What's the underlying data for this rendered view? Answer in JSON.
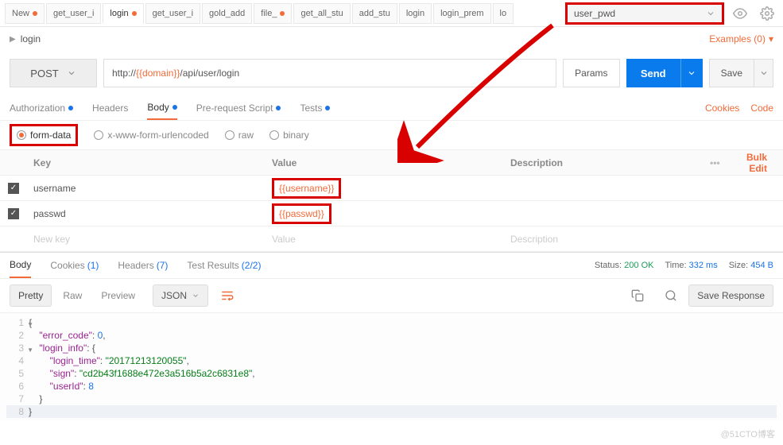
{
  "tabs": [
    {
      "label": "New",
      "dirty": true
    },
    {
      "label": "get_user_i",
      "dirty": false
    },
    {
      "label": "login",
      "dirty": true,
      "active": true
    },
    {
      "label": "get_user_i",
      "dirty": false
    },
    {
      "label": "gold_add",
      "dirty": false
    },
    {
      "label": "file_",
      "dirty": true
    },
    {
      "label": "get_all_stu",
      "dirty": false
    },
    {
      "label": "add_stu",
      "dirty": false
    },
    {
      "label": "login",
      "dirty": false
    },
    {
      "label": "login_prem",
      "dirty": false
    },
    {
      "label": "lo",
      "dirty": false
    }
  ],
  "env": {
    "selected": "user_pwd"
  },
  "breadcrumb": {
    "title": "login"
  },
  "examples": {
    "label": "Examples (0)"
  },
  "request": {
    "method": "POST",
    "url_prefix": "http://",
    "url_token": "{{domain}}",
    "url_suffix": "/api/user/login",
    "params_label": "Params",
    "send_label": "Send",
    "save_label": "Save"
  },
  "req_tabs": {
    "authorization": "Authorization",
    "headers": "Headers",
    "body": "Body",
    "prerequest": "Pre-request Script",
    "tests": "Tests",
    "cookies_link": "Cookies",
    "code_link": "Code"
  },
  "body_types": {
    "formdata": "form-data",
    "xwww": "x-www-form-urlencoded",
    "raw": "raw",
    "binary": "binary"
  },
  "kv": {
    "h_key": "Key",
    "h_value": "Value",
    "h_desc": "Description",
    "bulk": "Bulk Edit",
    "rows": [
      {
        "enabled": true,
        "key": "username",
        "value": "{{username}}"
      },
      {
        "enabled": true,
        "key": "passwd",
        "value": "{{passwd}}"
      }
    ],
    "ghost_key": "New key",
    "ghost_value": "Value",
    "ghost_desc": "Description"
  },
  "resp_tabs": {
    "body": "Body",
    "cookies": "Cookies",
    "cookies_count": "(1)",
    "headers": "Headers",
    "headers_count": "(7)",
    "testresults": "Test Results",
    "testresults_count": "(2/2)"
  },
  "resp_meta": {
    "status_label": "Status:",
    "status_value": "200 OK",
    "time_label": "Time:",
    "time_value": "332 ms",
    "size_label": "Size:",
    "size_value": "454 B"
  },
  "resp_tools": {
    "pretty": "Pretty",
    "raw": "Raw",
    "preview": "Preview",
    "format": "JSON",
    "save_response": "Save Response"
  },
  "json": {
    "l1": "{",
    "l2_k": "\"error_code\"",
    "l2_v": "0",
    "l3_k": "\"login_info\"",
    "l3_v": "{",
    "l4_k": "\"login_time\"",
    "l4_v": "\"20171213120055\"",
    "l5_k": "\"sign\"",
    "l5_v": "\"cd2b43f1688e472e3a516b5a2c6831e8\"",
    "l6_k": "\"userId\"",
    "l6_v": "8",
    "l7": "}",
    "l8": "}"
  },
  "watermark": "@51CTO博客"
}
